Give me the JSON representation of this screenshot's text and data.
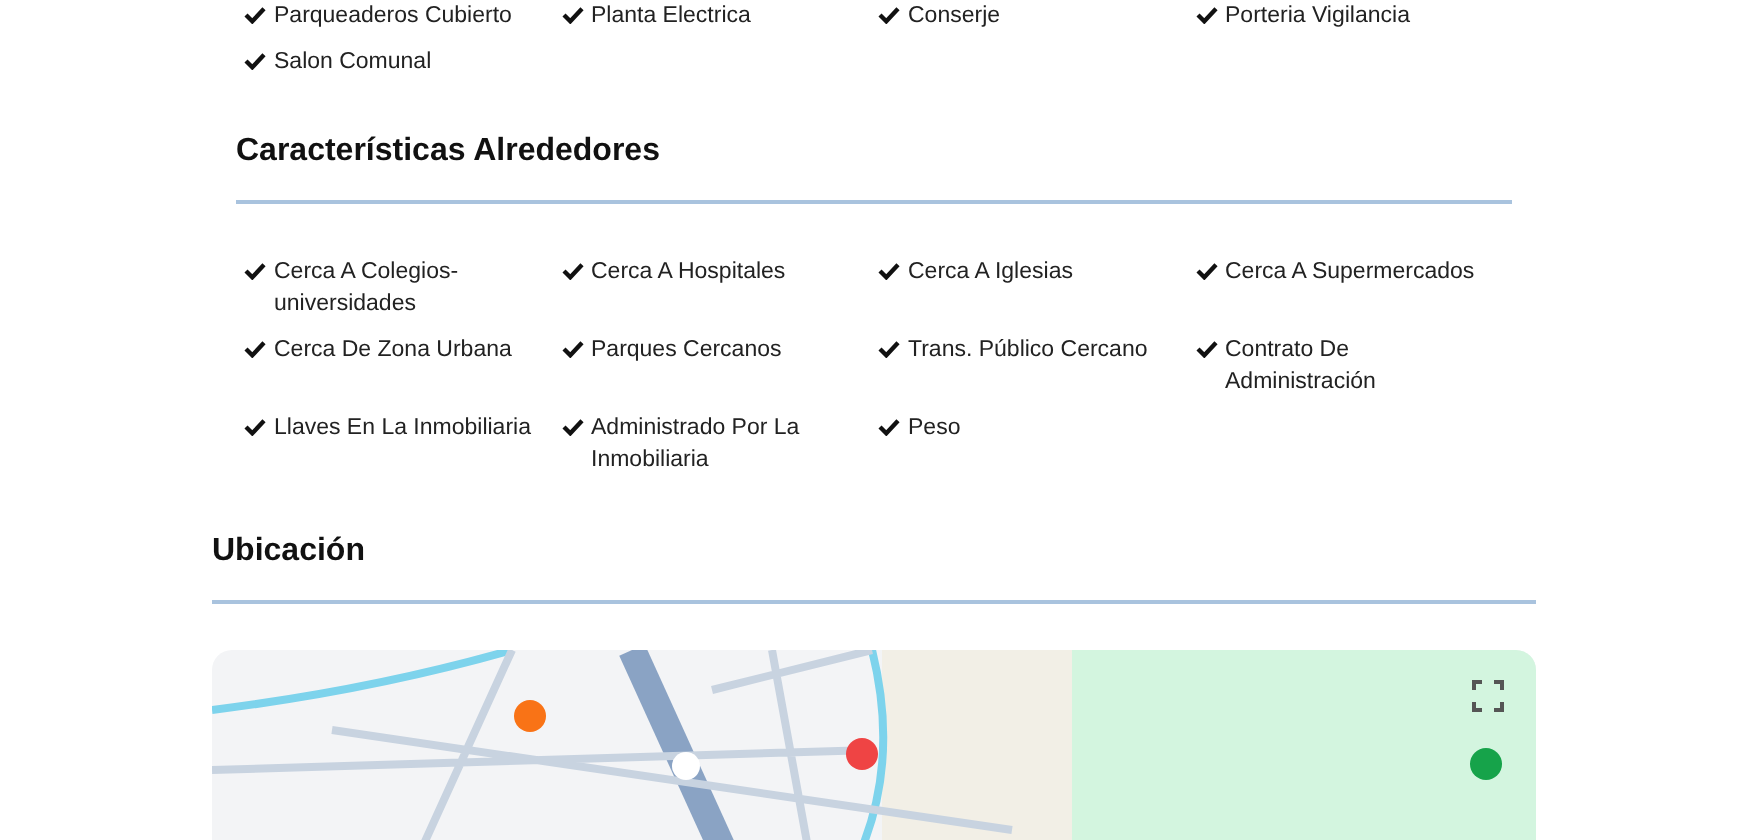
{
  "amenities": {
    "items": [
      "Parqueaderos Cubierto",
      "Planta Electrica",
      "Conserje",
      "Porteria Vigilancia",
      "Salon Comunal"
    ]
  },
  "surroundings": {
    "title": "Características Alrededores",
    "items": [
      "Cerca A Colegios-universidades",
      "Cerca A Hospitales",
      "Cerca A Iglesias",
      "Cerca A Supermercados",
      "Cerca De Zona Urbana",
      "Parques Cercanos",
      "Trans. Público Cercano",
      "Contrato De Administración",
      "Llaves En La Inmobiliaria",
      "Administrado Por La Inmobiliaria",
      "Peso"
    ]
  },
  "location": {
    "title": "Ubicación"
  }
}
